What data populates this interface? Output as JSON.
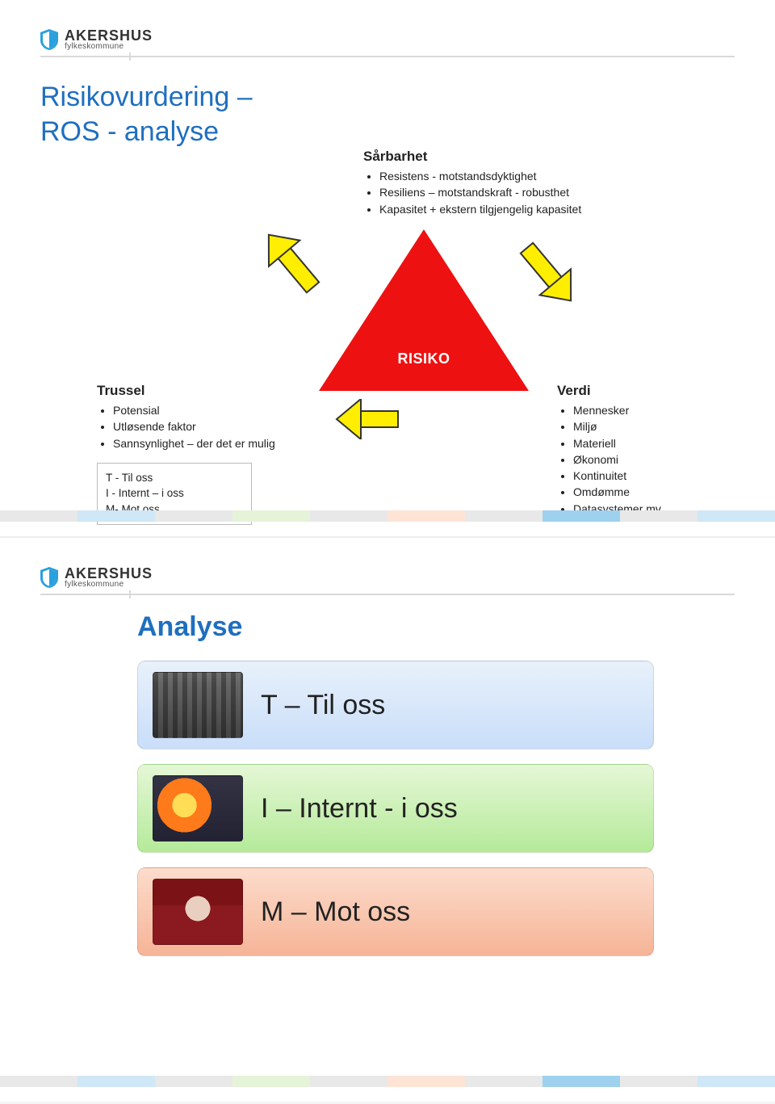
{
  "brand": {
    "name": "AKERSHUS",
    "sub": "fylkeskommune"
  },
  "slide1": {
    "title_line1": "Risikovurdering –",
    "title_line2": "ROS - analyse",
    "sarbarhet": {
      "head": "Sårbarhet",
      "items": [
        "Resistens - motstandsdyktighet",
        "Resiliens – motstandskraft - robusthet",
        "Kapasitet + ekstern tilgjengelig kapasitet"
      ]
    },
    "risiko_label": "RISIKO",
    "trussel": {
      "head": "Trussel",
      "items": [
        "Potensial",
        "Utløsende faktor",
        "Sannsynlighet – der det er mulig"
      ]
    },
    "tim": {
      "t": "T - Til oss",
      "i": "I  -  Internt – i oss",
      "m": "M- Mot oss"
    },
    "verdi": {
      "head": "Verdi",
      "items": [
        "Mennesker",
        "Miljø",
        "Materiell",
        "Økonomi",
        "Kontinuitet",
        "Omdømme",
        "Datasystemer mv."
      ]
    }
  },
  "slide2": {
    "title": "Analyse",
    "rows": [
      {
        "label": "T  – Til oss",
        "thumb": "traffic"
      },
      {
        "label": "I   – Internt - i oss",
        "thumb": "fire"
      },
      {
        "label": "M – Mot oss",
        "thumb": "person"
      }
    ]
  },
  "footbar_colors": [
    "#e8e8e8",
    "#cfe7f6",
    "#e8e8e8",
    "#e5f3d9",
    "#e8e8e8",
    "#fde4d5",
    "#e8e8e8",
    "#9ed1ed",
    "#e8e8e8",
    "#cfe7f6"
  ]
}
